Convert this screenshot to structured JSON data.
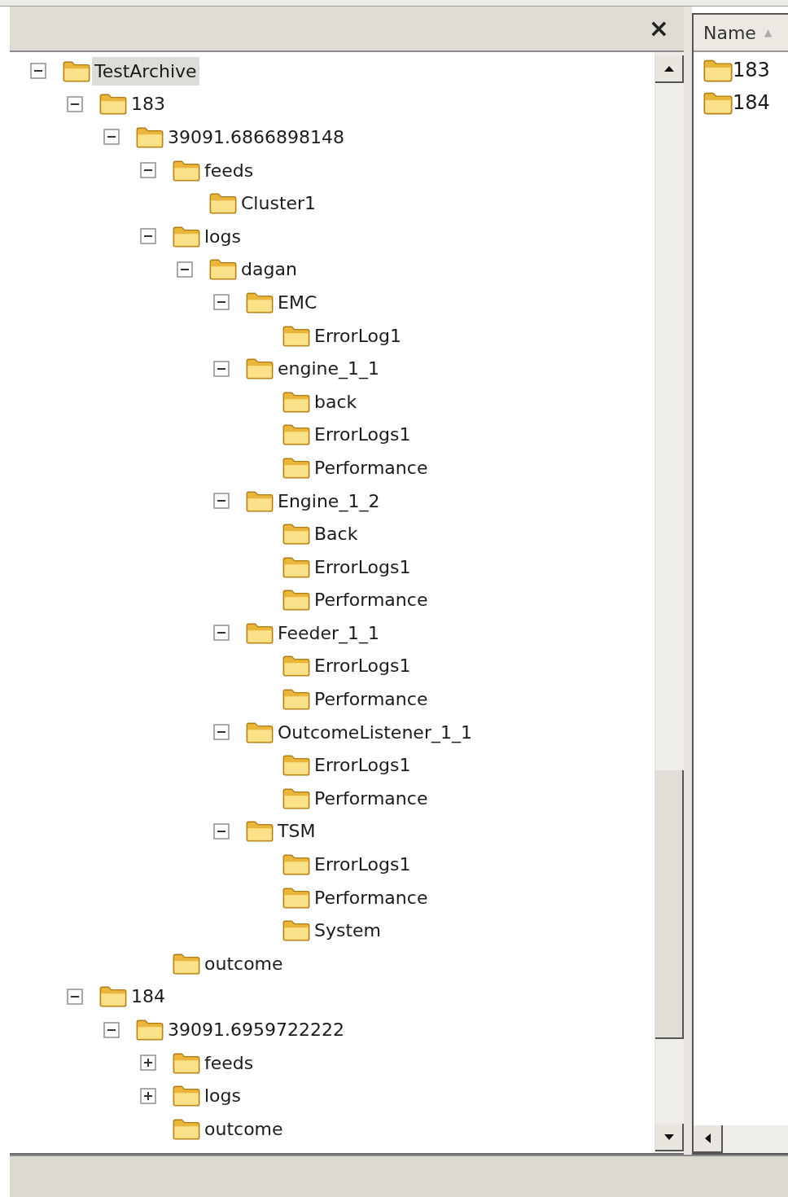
{
  "pane": {
    "close": "×"
  },
  "tree": [
    {
      "label": "TestArchive",
      "selected": true,
      "expanded": true,
      "children": [
        {
          "label": "183",
          "selected": false,
          "expanded": true,
          "children": [
            {
              "label": "39091.6866898148",
              "selected": false,
              "expanded": true,
              "children": [
                {
                  "label": "feeds",
                  "selected": false,
                  "expanded": true,
                  "children": [
                    {
                      "label": "Cluster1",
                      "selected": false
                    }
                  ]
                },
                {
                  "label": "logs",
                  "selected": false,
                  "expanded": true,
                  "children": [
                    {
                      "label": "dagan",
                      "selected": false,
                      "expanded": true,
                      "children": [
                        {
                          "label": "EMC",
                          "selected": false,
                          "expanded": true,
                          "children": [
                            {
                              "label": "ErrorLog1",
                              "selected": false
                            }
                          ]
                        },
                        {
                          "label": "engine_1_1",
                          "selected": false,
                          "expanded": true,
                          "children": [
                            {
                              "label": "back",
                              "selected": false
                            },
                            {
                              "label": "ErrorLogs1",
                              "selected": false
                            },
                            {
                              "label": "Performance",
                              "selected": false
                            }
                          ]
                        },
                        {
                          "label": "Engine_1_2",
                          "selected": false,
                          "expanded": true,
                          "children": [
                            {
                              "label": "Back",
                              "selected": false
                            },
                            {
                              "label": "ErrorLogs1",
                              "selected": false
                            },
                            {
                              "label": "Performance",
                              "selected": false
                            }
                          ]
                        },
                        {
                          "label": "Feeder_1_1",
                          "selected": false,
                          "expanded": true,
                          "children": [
                            {
                              "label": "ErrorLogs1",
                              "selected": false
                            },
                            {
                              "label": "Performance",
                              "selected": false
                            }
                          ]
                        },
                        {
                          "label": "OutcomeListener_1_1",
                          "selected": false,
                          "expanded": true,
                          "children": [
                            {
                              "label": "ErrorLogs1",
                              "selected": false
                            },
                            {
                              "label": "Performance",
                              "selected": false
                            }
                          ]
                        },
                        {
                          "label": "TSM",
                          "selected": false,
                          "expanded": true,
                          "children": [
                            {
                              "label": "ErrorLogs1",
                              "selected": false
                            },
                            {
                              "label": "Performance",
                              "selected": false
                            },
                            {
                              "label": "System",
                              "selected": false
                            }
                          ]
                        }
                      ]
                    }
                  ]
                },
                {
                  "label": "outcome",
                  "selected": false
                }
              ]
            }
          ]
        },
        {
          "label": "184",
          "selected": false,
          "expanded": true,
          "children": [
            {
              "label": "39091.6959722222",
              "selected": false,
              "expanded": true,
              "children": [
                {
                  "label": "feeds",
                  "selected": false,
                  "expanded": false
                },
                {
                  "label": "logs",
                  "selected": false,
                  "expanded": false
                },
                {
                  "label": "outcome",
                  "selected": false
                }
              ]
            }
          ]
        }
      ]
    }
  ],
  "list": {
    "columns": [
      {
        "label": "Name",
        "sort": "▲"
      }
    ],
    "items": [
      {
        "label": "183"
      },
      {
        "label": "184"
      }
    ]
  }
}
